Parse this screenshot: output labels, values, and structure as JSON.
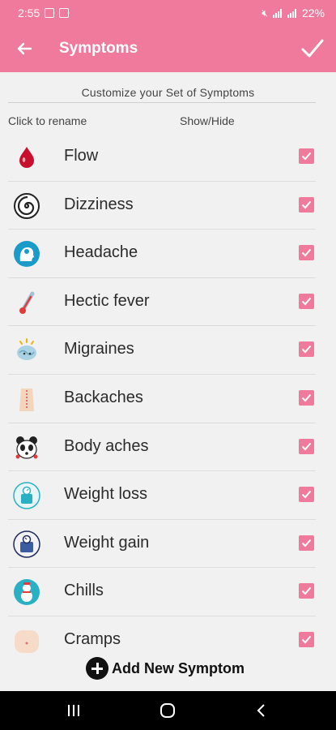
{
  "status_bar": {
    "time": "2:55",
    "battery": "22%"
  },
  "app_bar": {
    "title": "Symptoms"
  },
  "subtitle": "Customize your Set of Symptoms",
  "column_headers": {
    "rename": "Click to rename",
    "show_hide": "Show/Hide"
  },
  "symptoms": [
    {
      "label": "Flow",
      "icon": "blood-drop-icon",
      "checked": true
    },
    {
      "label": "Dizziness",
      "icon": "spiral-icon",
      "checked": true
    },
    {
      "label": "Headache",
      "icon": "head-icon",
      "checked": true
    },
    {
      "label": "Hectic fever",
      "icon": "thermometer-icon",
      "checked": true
    },
    {
      "label": "Migraines",
      "icon": "brain-icon",
      "checked": true
    },
    {
      "label": "Backaches",
      "icon": "back-icon",
      "checked": true
    },
    {
      "label": "Body aches",
      "icon": "panda-icon",
      "checked": true
    },
    {
      "label": "Weight loss",
      "icon": "scale-loss-icon",
      "checked": true
    },
    {
      "label": "Weight gain",
      "icon": "scale-gain-icon",
      "checked": true
    },
    {
      "label": "Chills",
      "icon": "snowman-icon",
      "checked": true
    },
    {
      "label": "Cramps",
      "icon": "belly-icon",
      "checked": true
    }
  ],
  "add_button": {
    "label": "Add New Symptom"
  },
  "colors": {
    "accent": "#ef7a9c",
    "background": "#f1f1f1"
  }
}
